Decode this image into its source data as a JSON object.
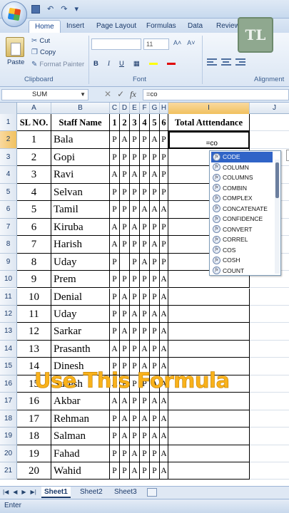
{
  "app": {
    "qat_undo": "↶",
    "qat_redo": "↷",
    "qat_more": "▾",
    "watermark": "TL"
  },
  "tabs": [
    {
      "label": "Home",
      "active": true
    },
    {
      "label": "Insert"
    },
    {
      "label": "Page Layout"
    },
    {
      "label": "Formulas"
    },
    {
      "label": "Data"
    },
    {
      "label": "Review"
    }
  ],
  "ribbon": {
    "paste": "Paste",
    "cut": "Cut",
    "copy": "Copy",
    "format_painter": "Format Painter",
    "font_size": "11",
    "grow_font": "A˄",
    "shrink_font": "A˅",
    "bold": "B",
    "italic": "I",
    "underline": "U",
    "groups": {
      "clipboard": "Clipboard",
      "font": "Font",
      "alignment": "Alignment"
    }
  },
  "formula_bar": {
    "name_box": "SUM",
    "content": "=co"
  },
  "columns": [
    "A",
    "B",
    "C",
    "D",
    "E",
    "F",
    "G",
    "H",
    "I",
    "J"
  ],
  "headers": {
    "sl": "SL NO.",
    "staff": "Staff Name",
    "days": [
      "1",
      "2",
      "3",
      "4",
      "5",
      "6"
    ],
    "total": "Total Atttendance"
  },
  "rows": [
    {
      "n": "1",
      "name": "Bala",
      "att": [
        "P",
        "A",
        "P",
        "P",
        "A",
        "P"
      ]
    },
    {
      "n": "2",
      "name": "Gopi",
      "att": [
        "P",
        "P",
        "P",
        "P",
        "P",
        "P"
      ]
    },
    {
      "n": "3",
      "name": "Ravi",
      "att": [
        "A",
        "P",
        "A",
        "P",
        "A",
        "P"
      ]
    },
    {
      "n": "4",
      "name": "Selvan",
      "att": [
        "P",
        "P",
        "P",
        "P",
        "P",
        "P"
      ]
    },
    {
      "n": "5",
      "name": "Tamil",
      "att": [
        "P",
        "P",
        "P",
        "A",
        "A",
        "A"
      ]
    },
    {
      "n": "6",
      "name": "Kiruba",
      "att": [
        "A",
        "P",
        "A",
        "P",
        "P",
        "P"
      ]
    },
    {
      "n": "7",
      "name": "Harish",
      "att": [
        "A",
        "P",
        "P",
        "P",
        "A",
        "P"
      ]
    },
    {
      "n": "8",
      "name": "Uday",
      "att": [
        "P",
        "",
        "P",
        "A",
        "P",
        "P"
      ]
    },
    {
      "n": "9",
      "name": "Prem",
      "att": [
        "P",
        "P",
        "P",
        "P",
        "P",
        "A"
      ]
    },
    {
      "n": "10",
      "name": "Denial",
      "att": [
        "P",
        "A",
        "P",
        "P",
        "P",
        "A"
      ]
    },
    {
      "n": "11",
      "name": "Uday",
      "att": [
        "P",
        "P",
        "A",
        "P",
        "A",
        "A"
      ]
    },
    {
      "n": "12",
      "name": "Sarkar",
      "att": [
        "P",
        "A",
        "P",
        "P",
        "P",
        "A"
      ]
    },
    {
      "n": "13",
      "name": "Prasanth",
      "att": [
        "A",
        "P",
        "P",
        "A",
        "P",
        "A"
      ]
    },
    {
      "n": "14",
      "name": "Dinesh",
      "att": [
        "P",
        "P",
        "P",
        "A",
        "P",
        "A"
      ]
    },
    {
      "n": "15",
      "name": "Suresh",
      "att": [
        "A",
        "P",
        "P",
        "P",
        "A",
        "A"
      ]
    },
    {
      "n": "16",
      "name": "Akbar",
      "att": [
        "A",
        "A",
        "P",
        "P",
        "A",
        "A"
      ]
    },
    {
      "n": "17",
      "name": "Rehman",
      "att": [
        "P",
        "A",
        "P",
        "A",
        "P",
        "A"
      ]
    },
    {
      "n": "18",
      "name": "Salman",
      "att": [
        "P",
        "A",
        "P",
        "P",
        "A",
        "A"
      ]
    },
    {
      "n": "19",
      "name": "Fahad",
      "att": [
        "P",
        "P",
        "A",
        "P",
        "P",
        "A"
      ]
    },
    {
      "n": "20",
      "name": "Wahid",
      "att": [
        "P",
        "P",
        "A",
        "P",
        "P",
        "A"
      ]
    }
  ],
  "row_numbers": [
    "1",
    "2",
    "3",
    "4",
    "5",
    "6",
    "7",
    "8",
    "9",
    "10",
    "11",
    "12",
    "13",
    "14",
    "15",
    "16",
    "17",
    "18",
    "19",
    "20",
    "21"
  ],
  "active_cell_text": "=co",
  "autocomplete": [
    "CODE",
    "COLUMN",
    "COLUMNS",
    "COMBIN",
    "COMPLEX",
    "CONCATENATE",
    "CONFIDENCE",
    "CONVERT",
    "CORREL",
    "COS",
    "COSH",
    "COUNT"
  ],
  "overlay_text": "Use This Formula",
  "sheets": [
    {
      "label": "Sheet1",
      "active": true
    },
    {
      "label": "Sheet2"
    },
    {
      "label": "Sheet3"
    }
  ],
  "status": "Enter"
}
